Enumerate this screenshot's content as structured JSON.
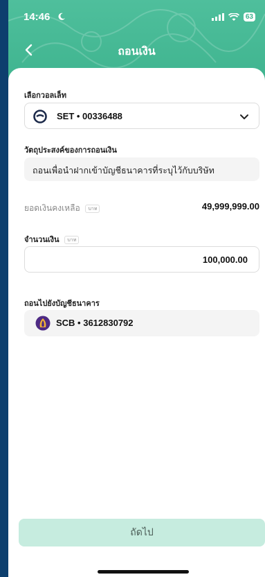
{
  "status_bar": {
    "time": "14:46",
    "signal": "",
    "battery": "63"
  },
  "nav": {
    "title": "ถอนเงิน"
  },
  "wallet": {
    "label": "เลือกวอลเล็ท",
    "selected": "SET • 00336488"
  },
  "purpose": {
    "label": "วัตถุประสงค์ของการถอนเงิน",
    "value": "ถอนเพื่อนำฝากเข้าบัญชีธนาคารที่ระบุไว้กับบริษัท"
  },
  "balance": {
    "label": "ยอดเงินคงเหลือ",
    "unit": "บาท",
    "value": "49,999,999.00"
  },
  "amount": {
    "label": "จำนวนเงิน",
    "unit": "บาท",
    "value": "100,000.00"
  },
  "bank": {
    "label": "ถอนไปยังบัญชีธนาคาร",
    "account": "SCB  •  3612830792"
  },
  "actions": {
    "next_label": "ถัดไป"
  },
  "colors": {
    "header": "#3fb48f",
    "button": "#c6ecdf",
    "scb_purple": "#4e2a84",
    "scb_gold": "#f2b134"
  }
}
